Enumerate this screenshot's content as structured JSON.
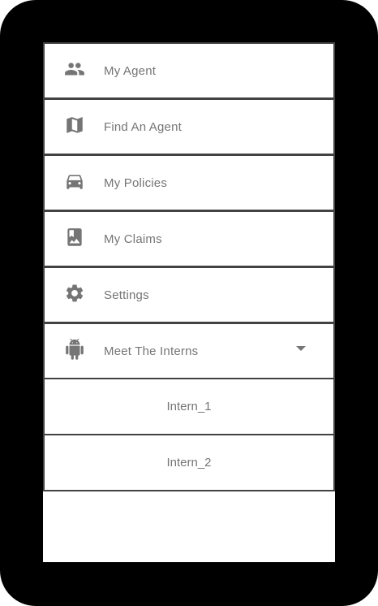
{
  "menu": {
    "items": [
      {
        "label": "My Agent",
        "icon": "people-icon"
      },
      {
        "label": "Find An Agent",
        "icon": "map-icon"
      },
      {
        "label": "My Policies",
        "icon": "car-icon"
      },
      {
        "label": "My Claims",
        "icon": "photo-album-icon"
      },
      {
        "label": "Settings",
        "icon": "gear-icon"
      },
      {
        "label": "Meet The Interns",
        "icon": "android-icon",
        "expander": "chevron-down-icon"
      }
    ],
    "sub_items": [
      {
        "label": "Intern_1"
      },
      {
        "label": "Intern_2"
      }
    ]
  },
  "colors": {
    "frame": "#000000",
    "screen": "#ffffff",
    "border": "#424242",
    "text": "#757575"
  }
}
